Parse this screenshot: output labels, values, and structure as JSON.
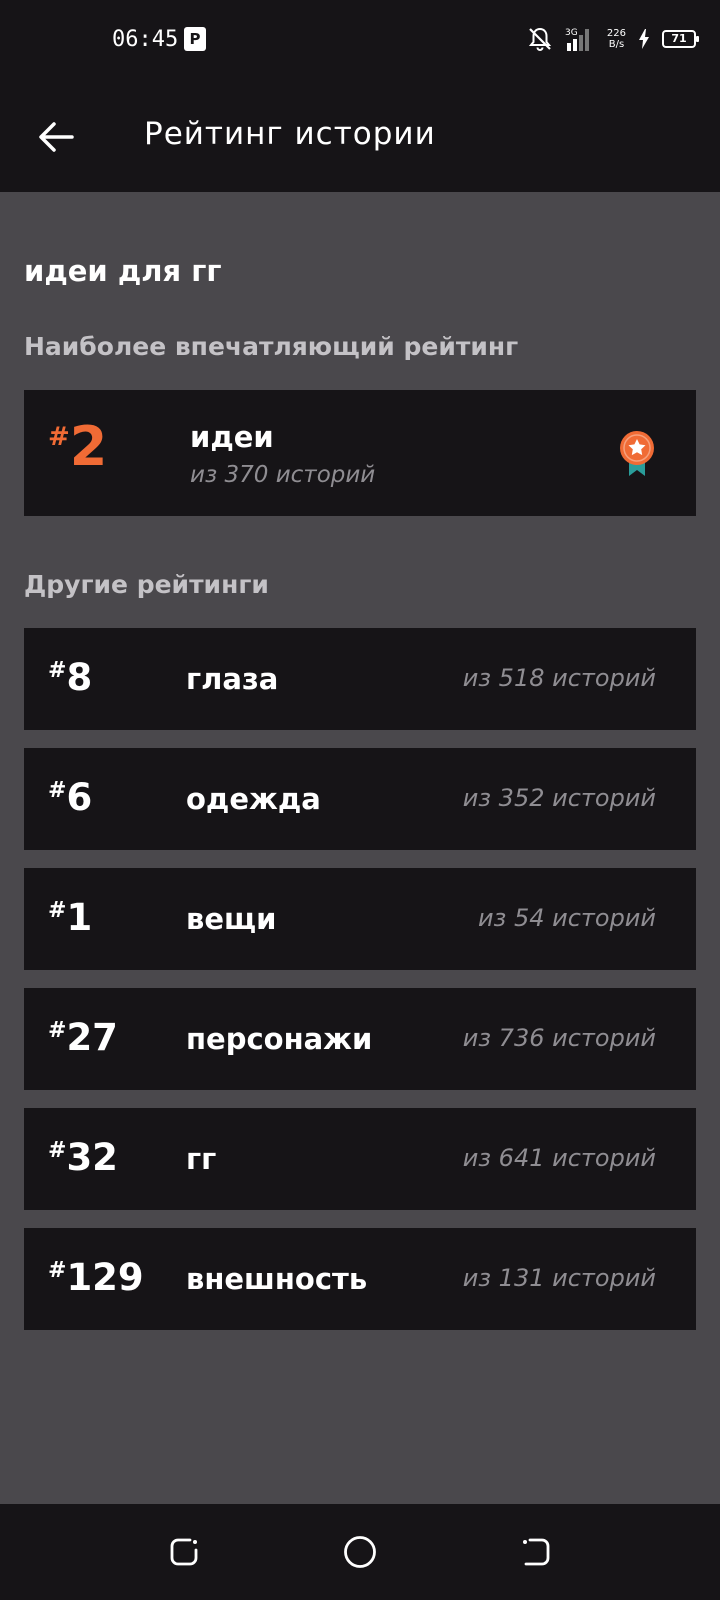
{
  "status_bar": {
    "time": "06:45",
    "p_icon": "P",
    "net_speed_value": "226",
    "net_speed_unit": "B/s",
    "battery": "71",
    "icons": [
      "muted-bell-icon",
      "signal-icon",
      "charging-icon",
      "battery-icon"
    ]
  },
  "app_bar": {
    "title": "Рейтинг истории",
    "back_icon": "back-arrow-icon"
  },
  "story": {
    "title": "идеи для гг"
  },
  "featured": {
    "section_label": "Наиболее впечатляющий рейтинг",
    "hash": "#",
    "rank": "2",
    "category": "идеи",
    "subtitle": "из 370 историй",
    "icon": "medal-icon",
    "accent_color": "#f06b35"
  },
  "others": {
    "section_label": "Другие рейтинги",
    "items": [
      {
        "hash": "#",
        "rank": "8",
        "category": "глаза",
        "subtitle": "из 518 историй"
      },
      {
        "hash": "#",
        "rank": "6",
        "category": "одежда",
        "subtitle": "из 352 историй"
      },
      {
        "hash": "#",
        "rank": "1",
        "category": "вещи",
        "subtitle": "из 54 историй"
      },
      {
        "hash": "#",
        "rank": "27",
        "category": "персонажи",
        "subtitle": "из 736 историй"
      },
      {
        "hash": "#",
        "rank": "32",
        "category": "гг",
        "subtitle": "из 641 историй"
      },
      {
        "hash": "#",
        "rank": "129",
        "category": "внешность",
        "subtitle": "из 131 историй"
      }
    ]
  },
  "nav_bar": {
    "icons": [
      "recents-icon",
      "home-icon",
      "back-icon"
    ]
  }
}
